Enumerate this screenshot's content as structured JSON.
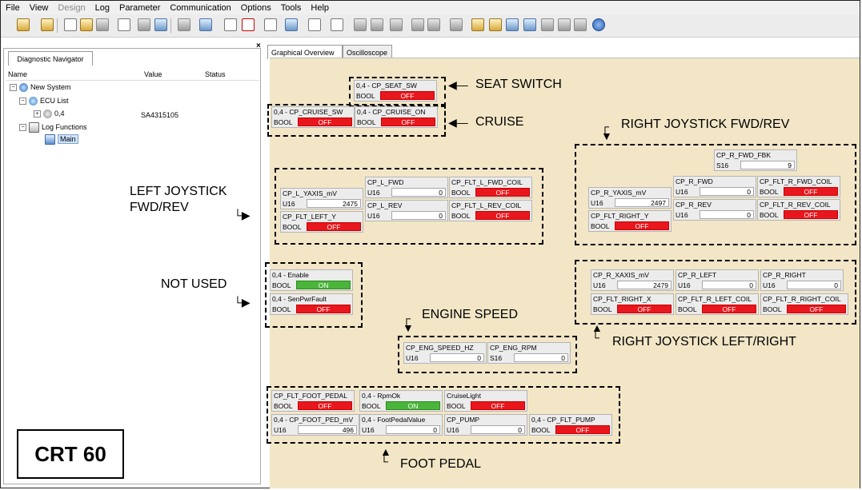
{
  "menu": [
    "File",
    "View",
    "Design",
    "Log",
    "Parameter",
    "Communication",
    "Options",
    "Tools",
    "Help"
  ],
  "menu_disabled": [
    "Design"
  ],
  "navigator": {
    "tab": "Diagnostic Navigator",
    "columns": {
      "name": "Name",
      "value": "Value",
      "status": "Status"
    },
    "items": [
      {
        "label": "New System",
        "value": ""
      },
      {
        "label": "ECU List",
        "value": ""
      },
      {
        "label": "0,4",
        "value": "SA4315105"
      },
      {
        "label": "Log Functions",
        "value": ""
      },
      {
        "label": "Main",
        "value": ""
      }
    ]
  },
  "tabs": [
    "Graphical Overview",
    "Oscilloscope"
  ],
  "badge": "CRT 60",
  "annotations": {
    "seat_switch": "SEAT SWITCH",
    "cruise": "CRUISE",
    "right_fwd_rev": "RIGHT JOYSTICK FWD/REV",
    "left_joy_1": "LEFT JOYSTICK",
    "left_joy_2": "FWD/REV",
    "not_used": "NOT USED",
    "engine_speed": "ENGINE SPEED",
    "right_left_right": "RIGHT JOYSTICK LEFT/RIGHT",
    "foot_pedal": "FOOT PEDAL"
  },
  "widgets": {
    "seat_sw": {
      "name": "0,4 - CP_SEAT_SW",
      "type": "BOOL",
      "value": "OFF"
    },
    "cruise_sw": {
      "name": "0,4 - CP_CRUISE_SW",
      "type": "BOOL",
      "value": "OFF"
    },
    "cruise_on": {
      "name": "0,4 - CP_CRUISE_ON",
      "type": "BOOL",
      "value": "OFF"
    },
    "l_yaxis": {
      "name": "CP_L_YAXIS_mV",
      "type": "U16",
      "value": "2475"
    },
    "l_fwd": {
      "name": "CP_L_FWD",
      "type": "U16",
      "value": "0"
    },
    "flt_l_fwd_coil": {
      "name": "CP_FLT_L_FWD_COIL",
      "type": "BOOL",
      "value": "OFF"
    },
    "flt_left_y": {
      "name": "CP_FLT_LEFT_Y",
      "type": "BOOL",
      "value": "OFF"
    },
    "l_rev": {
      "name": "CP_L_REV",
      "type": "U16",
      "value": "0"
    },
    "flt_l_rev_coil": {
      "name": "CP_FLT_L_REV_COIL",
      "type": "BOOL",
      "value": "OFF"
    },
    "r_fwd_fbk": {
      "name": "CP_R_FWD_FBK",
      "type": "S16",
      "value": "9"
    },
    "r_yaxis": {
      "name": "CP_R_YAXIS_mV",
      "type": "U16",
      "value": "2497"
    },
    "r_fwd": {
      "name": "CP_R_FWD",
      "type": "U16",
      "value": "0"
    },
    "flt_r_fwd_coil": {
      "name": "CP_FLT_R_FWD_COIL",
      "type": "BOOL",
      "value": "OFF"
    },
    "flt_right_y": {
      "name": "CP_FLT_RIGHT_Y",
      "type": "BOOL",
      "value": "OFF"
    },
    "r_rev": {
      "name": "CP_R_REV",
      "type": "U16",
      "value": "0"
    },
    "flt_r_rev_coil": {
      "name": "CP_FLT_R_REV_COIL",
      "type": "BOOL",
      "value": "OFF"
    },
    "enable": {
      "name": "0,4 - Enable",
      "type": "BOOL",
      "value": "ON"
    },
    "senpwrfault": {
      "name": "0,4 - SenPwrFault",
      "type": "BOOL",
      "value": "OFF"
    },
    "r_xaxis": {
      "name": "CP_R_XAXIS_mV",
      "type": "U16",
      "value": "2479"
    },
    "r_left": {
      "name": "CP_R_LEFT",
      "type": "U16",
      "value": "0"
    },
    "r_right": {
      "name": "CP_R_RIGHT",
      "type": "U16",
      "value": "0"
    },
    "flt_right_x": {
      "name": "CP_FLT_RIGHT_X",
      "type": "BOOL",
      "value": "OFF"
    },
    "flt_r_left_coil": {
      "name": "CP_FLT_R_LEFT_COIL",
      "type": "BOOL",
      "value": "OFF"
    },
    "flt_r_right_coil": {
      "name": "CP_FLT_R_RIGHT_COIL",
      "type": "BOOL",
      "value": "OFF"
    },
    "eng_speed_hz": {
      "name": "CP_ENG_SPEED_HZ",
      "type": "U16",
      "value": "0"
    },
    "eng_rpm": {
      "name": "CP_ENG_RPM",
      "type": "S16",
      "value": "0"
    },
    "flt_foot_pedal": {
      "name": "CP_FLT_FOOT_PEDAL",
      "type": "BOOL",
      "value": "OFF"
    },
    "rpmok": {
      "name": "0,4 - RpmOk",
      "type": "BOOL",
      "value": "ON"
    },
    "cruiselight": {
      "name": "CruiseLight",
      "type": "BOOL",
      "value": "OFF"
    },
    "foot_ped_mv": {
      "name": "0,4 - CP_FOOT_PED_mV",
      "type": "U16",
      "value": "496"
    },
    "footpedalvalue": {
      "name": "0,4 - FootPedalValue",
      "type": "U16",
      "value": "0"
    },
    "cp_pump": {
      "name": "CP_PUMP",
      "type": "U16",
      "value": "0"
    },
    "flt_pump": {
      "name": "0,4 - CP_FLT_PUMP",
      "type": "BOOL",
      "value": "OFF"
    }
  }
}
